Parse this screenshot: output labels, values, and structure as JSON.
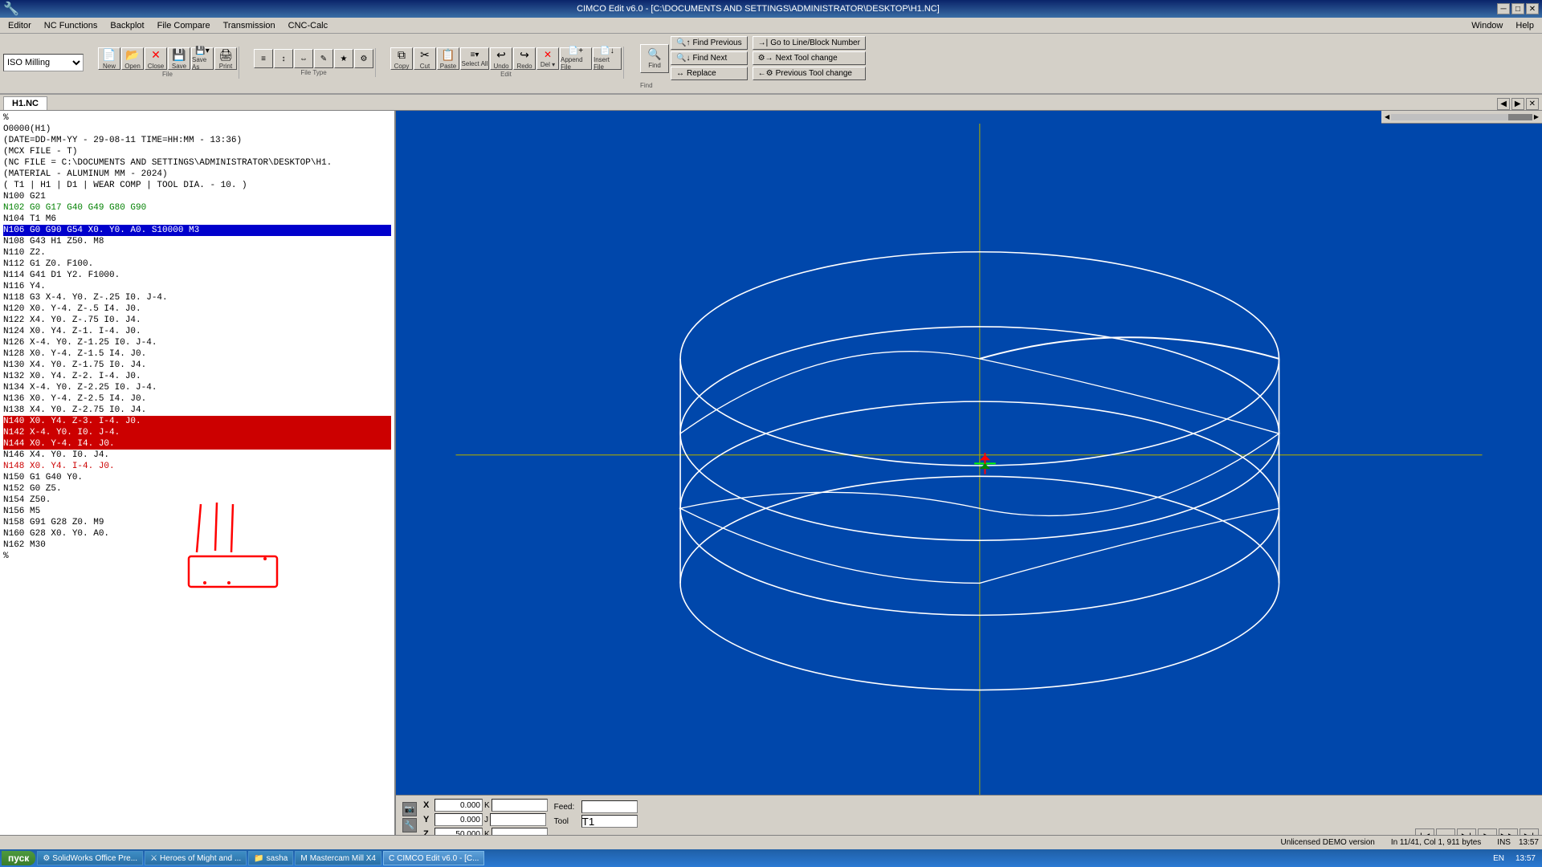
{
  "titlebar": {
    "title": "CIMCO Edit v6.0 - [C:\\DOCUMENTS AND SETTINGS\\ADMINISTRATOR\\DESKTOP\\H1.NC]",
    "min": "─",
    "max": "□",
    "close": "✕"
  },
  "menubar": {
    "items": [
      "Editor",
      "NC Functions",
      "Backplot",
      "File Compare",
      "Transmission",
      "CNC-Calc",
      "Window",
      "Help"
    ]
  },
  "toolbar": {
    "filetypes": [
      "ISO Milling"
    ],
    "file_group": {
      "label": "File",
      "buttons": [
        {
          "id": "new",
          "icon": "📄",
          "label": "New"
        },
        {
          "id": "open",
          "icon": "📂",
          "label": "Open"
        },
        {
          "id": "close",
          "icon": "✕",
          "label": "Close"
        },
        {
          "id": "save",
          "icon": "💾",
          "label": "Save"
        },
        {
          "id": "saveas",
          "icon": "💾",
          "label": "Save As"
        },
        {
          "id": "print",
          "icon": "🖨",
          "label": "Print"
        }
      ]
    },
    "filetype_group": {
      "label": "File Type"
    },
    "edit_group": {
      "label": "Edit",
      "buttons": [
        {
          "id": "copy",
          "icon": "⧉",
          "label": "Copy"
        },
        {
          "id": "cut",
          "icon": "✂",
          "label": "Cut"
        },
        {
          "id": "paste",
          "icon": "📋",
          "label": "Paste"
        },
        {
          "id": "selectall",
          "icon": "≡",
          "label": "Select All"
        },
        {
          "id": "undo",
          "icon": "↩",
          "label": "Undo"
        },
        {
          "id": "redo",
          "icon": "↪",
          "label": "Redo"
        },
        {
          "id": "delete",
          "icon": "✕",
          "label": "Del"
        },
        {
          "id": "appendfile",
          "icon": "+",
          "label": "Append File"
        },
        {
          "id": "insertfile",
          "icon": "↓",
          "label": "Insert File"
        }
      ]
    },
    "find_group": {
      "label": "Find",
      "buttons": [
        {
          "id": "find",
          "icon": "🔍",
          "label": "Find"
        },
        {
          "id": "findprev",
          "label": "Find Previous"
        },
        {
          "id": "findnext",
          "label": "Find Next"
        },
        {
          "id": "replace",
          "label": "Replace"
        },
        {
          "id": "gotoline",
          "label": "Go to Line/Block Number"
        },
        {
          "id": "nexttool",
          "label": "Next Tool change"
        },
        {
          "id": "prevtool",
          "label": "Previous Tool change"
        }
      ]
    }
  },
  "tab": {
    "name": "H1.NC"
  },
  "editor": {
    "lines": [
      {
        "n": 1,
        "text": "%",
        "style": ""
      },
      {
        "n": 2,
        "text": "O0000(H1)",
        "style": ""
      },
      {
        "n": 3,
        "text": "(DATE=DD-MM-YY - 29-08-11 TIME=HH:MM - 13:36)",
        "style": ""
      },
      {
        "n": 4,
        "text": "(MCX FILE - T)",
        "style": ""
      },
      {
        "n": 5,
        "text": "(NC FILE = C:\\DOCUMENTS AND SETTINGS\\ADMINISTRATOR\\DESKTOP\\H1.",
        "style": ""
      },
      {
        "n": 6,
        "text": "(MATERIAL - ALUMINUM MM - 2024)",
        "style": ""
      },
      {
        "n": 7,
        "text": "( T1 | H1 | D1 | WEAR COMP | TOOL DIA. - 10. )",
        "style": ""
      },
      {
        "n": 8,
        "text": "N100 G21",
        "style": ""
      },
      {
        "n": 9,
        "text": "N102 G0 G17 G40 G49 G80 G90",
        "style": "green"
      },
      {
        "n": 10,
        "text": "N104 T1 M6",
        "style": ""
      },
      {
        "n": 11,
        "text": "N106 G0 G90 G54 X0. Y0. A0. S10000 M3",
        "style": "blue-highlight"
      },
      {
        "n": 12,
        "text": "N108 G43 H1 Z50. M8",
        "style": ""
      },
      {
        "n": 13,
        "text": "N110 Z2.",
        "style": ""
      },
      {
        "n": 14,
        "text": "N112 G1 Z0. F100.",
        "style": ""
      },
      {
        "n": 15,
        "text": "N114 G41 D1 Y2. F1000.",
        "style": ""
      },
      {
        "n": 16,
        "text": "N116 Y4.",
        "style": ""
      },
      {
        "n": 17,
        "text": "N118 G3 X-4. Y0. Z-.25 I0. J-4.",
        "style": ""
      },
      {
        "n": 18,
        "text": "N120 X0. Y-4. Z-.5 I4. J0.",
        "style": ""
      },
      {
        "n": 19,
        "text": "N122 X4. Y0. Z-.75 I0. J4.",
        "style": ""
      },
      {
        "n": 20,
        "text": "N124 X0. Y4. Z-1. I-4. J0.",
        "style": ""
      },
      {
        "n": 21,
        "text": "N126 X-4. Y0. Z-1.25 I0. J-4.",
        "style": ""
      },
      {
        "n": 22,
        "text": "N128 X0. Y-4. Z-1.5 I4. J0.",
        "style": ""
      },
      {
        "n": 23,
        "text": "N130 X4. Y0. Z-1.75 I0. J4.",
        "style": ""
      },
      {
        "n": 24,
        "text": "N132 X0. Y4. Z-2. I-4. J0.",
        "style": ""
      },
      {
        "n": 25,
        "text": "N134 X-4. Y0. Z-2.25 I0. J-4.",
        "style": ""
      },
      {
        "n": 26,
        "text": "N136 X0. Y-4. Z-2.5 I4. J0.",
        "style": ""
      },
      {
        "n": 27,
        "text": "N138 X4. Y0. Z-2.75 I0. J4.",
        "style": ""
      },
      {
        "n": 28,
        "text": "N140 X0. Y4. Z-3. I-4. J0.",
        "style": "red-highlight"
      },
      {
        "n": 29,
        "text": "N142 X-4. Y0. I0. J-4.",
        "style": "red-highlight"
      },
      {
        "n": 30,
        "text": "N144 X0. Y-4. I4. J0.",
        "style": "red-highlight"
      },
      {
        "n": 31,
        "text": "N146 X4. Y0. I0. J4.",
        "style": ""
      },
      {
        "n": 32,
        "text": "N148 X0. Y4. I-4. J0.",
        "style": "red-end"
      },
      {
        "n": 33,
        "text": "N150 G1 G40 Y0.",
        "style": ""
      },
      {
        "n": 34,
        "text": "N152 G0 Z5.",
        "style": ""
      },
      {
        "n": 35,
        "text": "N154 Z50.",
        "style": ""
      },
      {
        "n": 36,
        "text": "N156 M5",
        "style": ""
      },
      {
        "n": 37,
        "text": "N158 G91 G28 Z0. M9",
        "style": ""
      },
      {
        "n": 38,
        "text": "N160 G28 X0. Y0. A0.",
        "style": ""
      },
      {
        "n": 39,
        "text": "N162 M30",
        "style": ""
      },
      {
        "n": 40,
        "text": "%",
        "style": ""
      }
    ]
  },
  "coords": {
    "x_label": "X",
    "x_value": "0.000",
    "y_label": "Y",
    "y_value": "0.000",
    "z_label": "Z",
    "z_value": "50.000",
    "k_label": "K",
    "feed_label": "Feed:",
    "tool_label": "Tool",
    "tool_value": "T1"
  },
  "statusbar": {
    "left": "",
    "right": "Unlicensed DEMO version",
    "pos": "In 11/41, Col 1, 911 bytes",
    "mode": "INS",
    "time": "13:57"
  },
  "taskbar": {
    "start": "пуск",
    "items": [
      {
        "label": "SolidWorks Office Pre...",
        "icon": "⚙",
        "active": false
      },
      {
        "label": "Heroes of Might and ...",
        "icon": "⚔",
        "active": false
      },
      {
        "label": "sasha",
        "icon": "📁",
        "active": false
      },
      {
        "label": "Mastercam Mill X4",
        "icon": "M",
        "active": false
      },
      {
        "label": "CIMCO Edit v6.0 - [C...",
        "icon": "C",
        "active": true
      }
    ],
    "lang": "EN",
    "time": "13:57"
  }
}
